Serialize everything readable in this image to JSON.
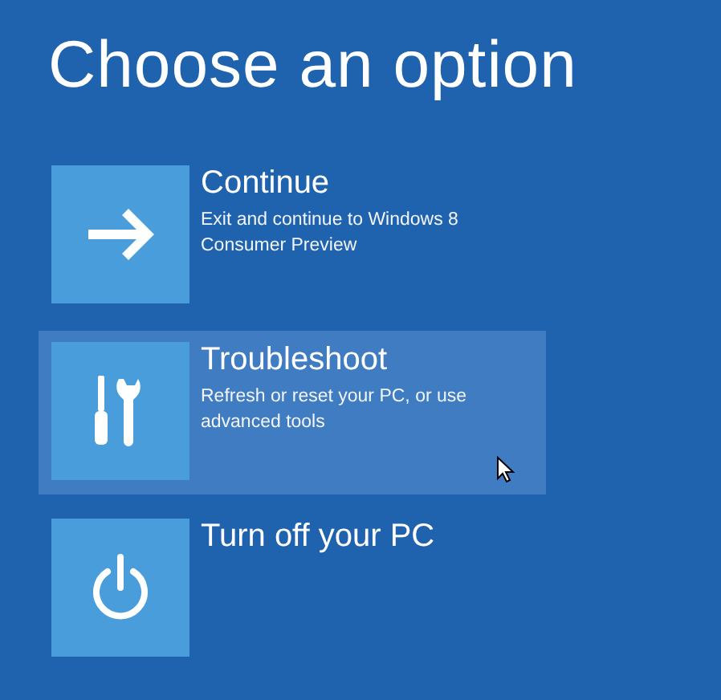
{
  "title": "Choose an option",
  "options": [
    {
      "kind": "continue",
      "label": "Continue",
      "description": "Exit and continue to Windows 8 Consumer Preview",
      "selected": false
    },
    {
      "kind": "troubleshoot",
      "label": "Troubleshoot",
      "description": "Refresh or reset your PC, or use advanced tools",
      "selected": true
    },
    {
      "kind": "power",
      "label": "Turn off your PC",
      "selected": false
    }
  ]
}
